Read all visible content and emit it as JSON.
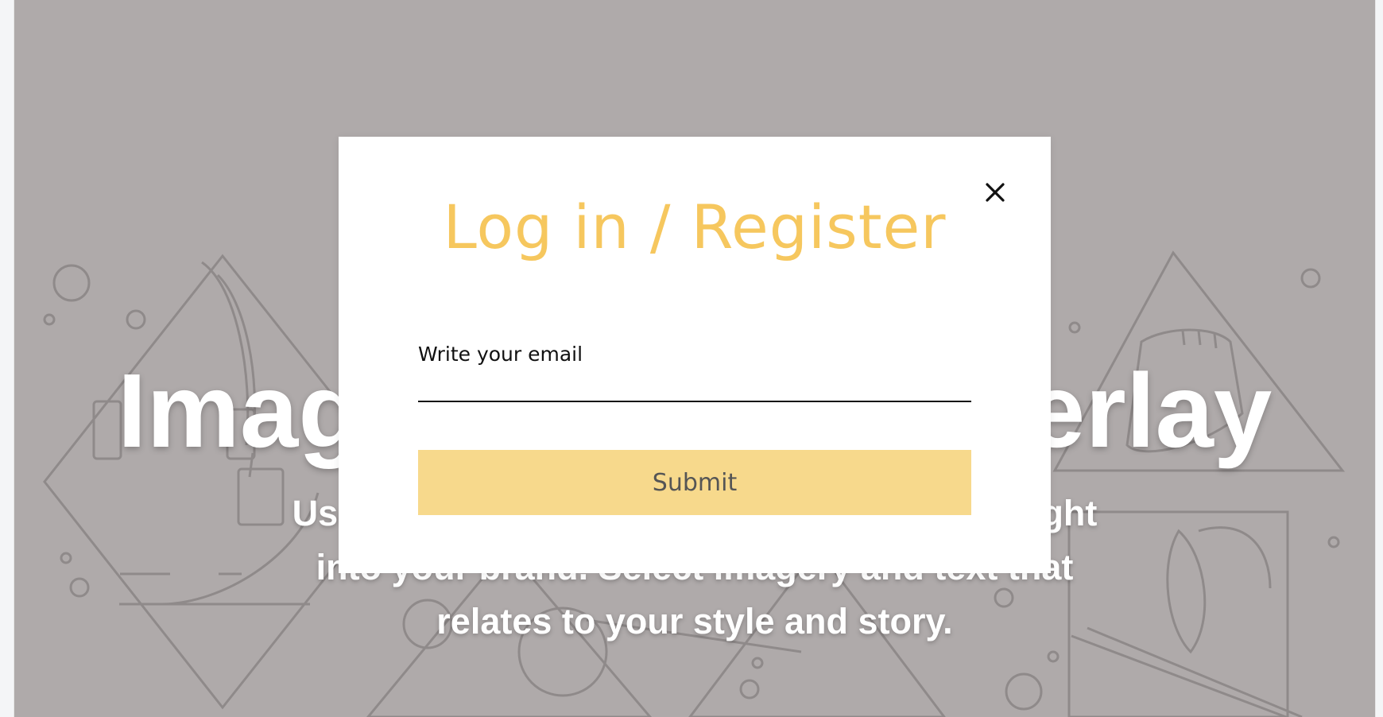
{
  "hero": {
    "title": "Image with text overlay",
    "subtitle": "Use overlay text to give your customers insight into your brand. Select imagery and text that relates to your style and story.",
    "background_color": "#afaaaa"
  },
  "modal": {
    "title": "Log in / Register",
    "email_label": "Write your email",
    "email_value": "",
    "submit_label": "Submit",
    "close_icon": "close-icon",
    "title_color": "#f6c75e",
    "button_color": "#f7d98c"
  }
}
